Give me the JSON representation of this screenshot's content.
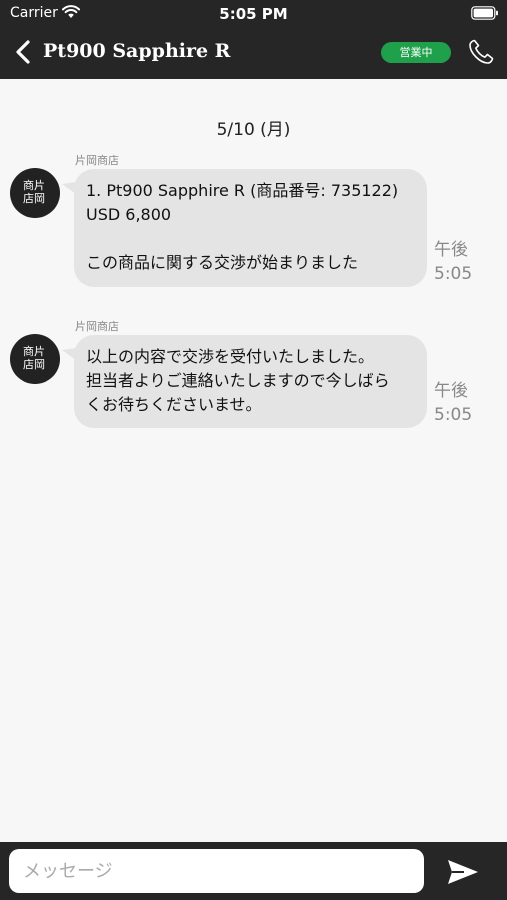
{
  "status_bar": {
    "carrier": "Carrier",
    "time": "5:05 PM"
  },
  "header": {
    "title": "Pt900 Sapphire R",
    "badge": "営業中"
  },
  "chat": {
    "date": "5/10 (月)",
    "messages": [
      {
        "sender": "片岡商店",
        "avatar_top": "商片",
        "avatar_bottom": "店岡",
        "line1": "1. Pt900 Sapphire R (商品番号: 735122)",
        "line2": "USD 6,800",
        "line3": "",
        "line4": "この商品に関する交渉が始まりました",
        "time_period": "午後",
        "time": "5:05"
      },
      {
        "sender": "片岡商店",
        "avatar_top": "商片",
        "avatar_bottom": "店岡",
        "line1": "以上の内容で交渉を受付いたしました。",
        "line2": "担当者よりご連絡いたしますので今しばら",
        "line3": "くお待ちくださいませ。",
        "time_period": "午後",
        "time": "5:05"
      }
    ]
  },
  "composer": {
    "placeholder": "メッセージ"
  },
  "icons": {
    "back": "chevron-left-icon",
    "phone": "phone-icon",
    "send": "send-icon",
    "wifi": "wifi-icon",
    "battery": "battery-icon"
  },
  "colors": {
    "bar": "#262626",
    "badge": "#1fa04b",
    "bubble": "#e4e4e4",
    "background": "#f7f7f7"
  }
}
